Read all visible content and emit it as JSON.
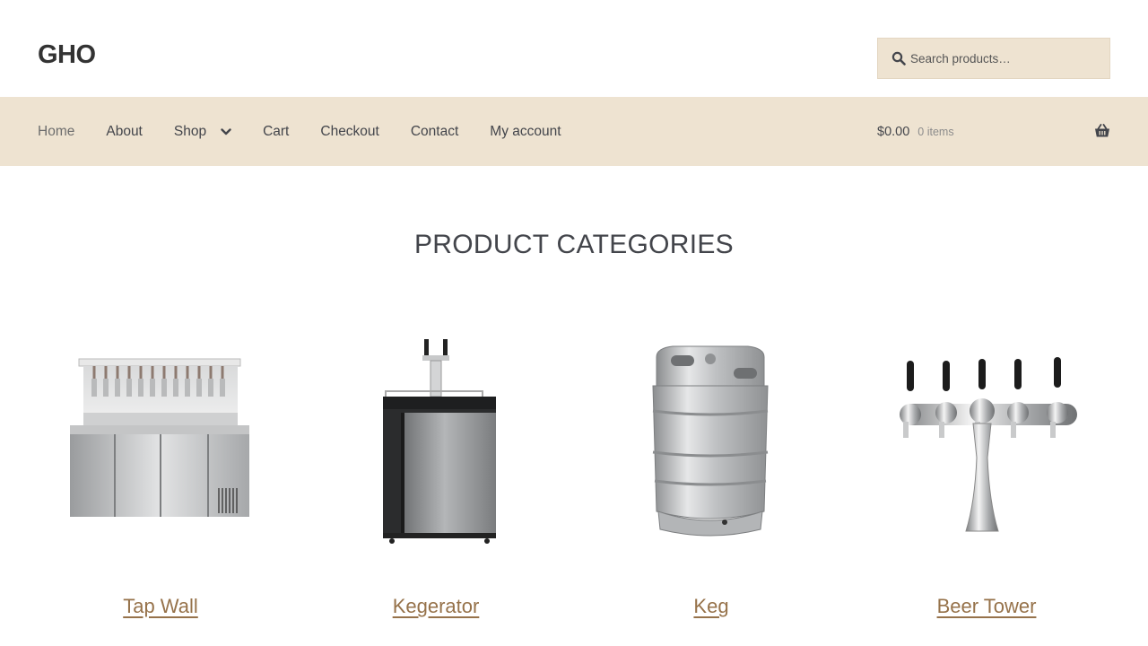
{
  "site": {
    "title": "GHO"
  },
  "search": {
    "placeholder": "Search products…",
    "value": ""
  },
  "nav": {
    "items": [
      {
        "label": "Home",
        "current": true
      },
      {
        "label": "About"
      },
      {
        "label": "Shop",
        "has_dropdown": true
      },
      {
        "label": "Cart"
      },
      {
        "label": "Checkout"
      },
      {
        "label": "Contact"
      },
      {
        "label": "My account"
      }
    ]
  },
  "cart": {
    "amount": "$0.00",
    "count": "0 items",
    "icon": "basket-icon"
  },
  "main": {
    "title": "PRODUCT CATEGORIES",
    "categories": [
      {
        "name": "Tap Wall",
        "image": "tap-wall-image"
      },
      {
        "name": "Kegerator",
        "image": "kegerator-image"
      },
      {
        "name": "Keg",
        "image": "keg-image"
      },
      {
        "name": "Beer Tower",
        "image": "beer-tower-image"
      }
    ]
  },
  "colors": {
    "header_bg": "#ffffff",
    "nav_bg": "#eee3d1",
    "link": "#96724a",
    "text": "#43454b"
  }
}
